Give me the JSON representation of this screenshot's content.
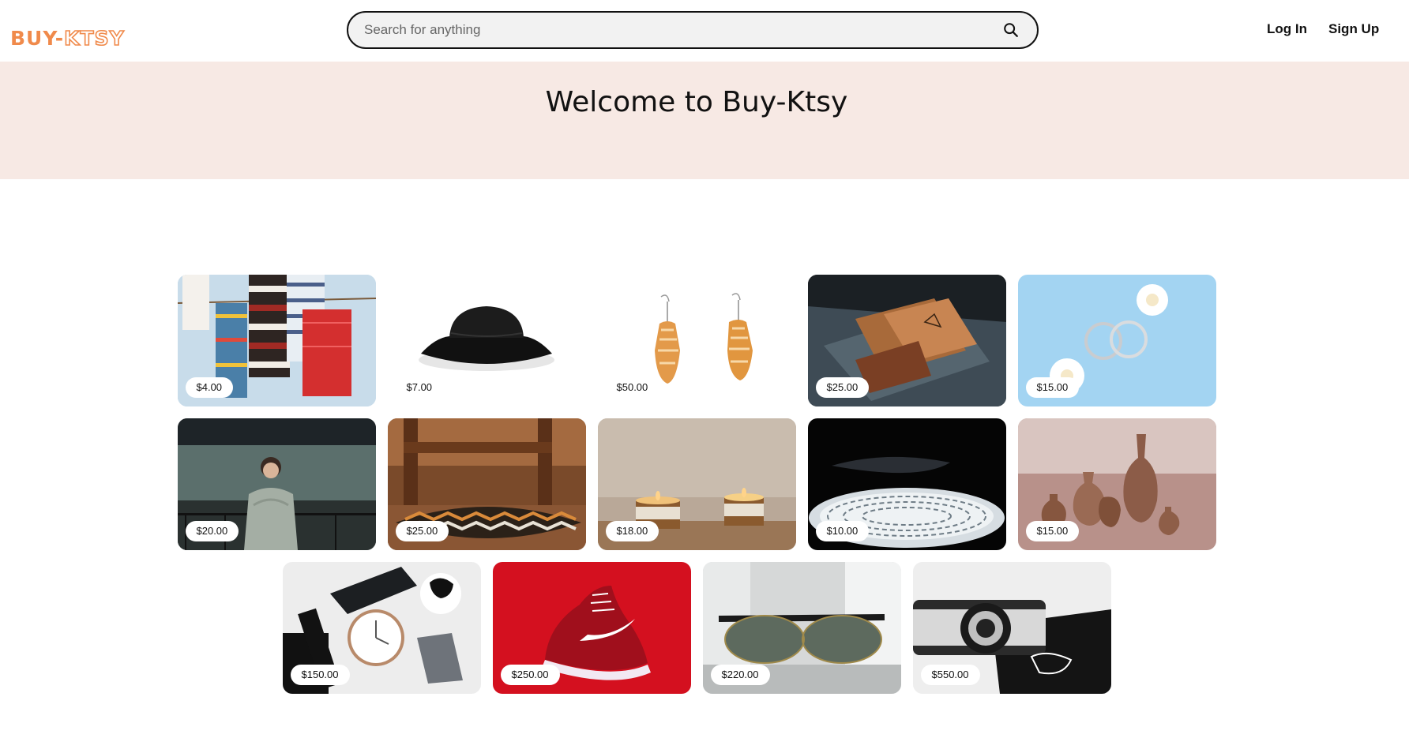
{
  "header": {
    "logo_prefix": "BUY-",
    "logo_suffix": "KTSY",
    "search_placeholder": "Search for anything",
    "search_icon": "search-icon",
    "login_label": "Log In",
    "signup_label": "Sign Up"
  },
  "banner": {
    "title": "Welcome to Buy-Ktsy"
  },
  "colors": {
    "brand": "#f08a4b",
    "banner_bg": "#f7e9e4",
    "search_bg": "#f2f2f2"
  },
  "products": [
    {
      "price": "$4.00",
      "image": "knitted-scarves"
    },
    {
      "price": "$7.00",
      "image": "black-bucket-hat"
    },
    {
      "price": "$50.00",
      "image": "seashell-earrings"
    },
    {
      "price": "$25.00",
      "image": "leather-card-wallets"
    },
    {
      "price": "$15.00",
      "image": "silver-hoop-earrings"
    },
    {
      "price": "$20.00",
      "image": "woman-in-knit-sweater"
    },
    {
      "price": "$25.00",
      "image": "patterned-floor-cushion"
    },
    {
      "price": "$18.00",
      "image": "amber-jar-candles"
    },
    {
      "price": "$10.00",
      "image": "patterned-ceramic-plate"
    },
    {
      "price": "$15.00",
      "image": "clay-vases"
    },
    {
      "price": "$150.00",
      "image": "wrist-watch"
    },
    {
      "price": "$250.00",
      "image": "red-running-shoe"
    },
    {
      "price": "$220.00",
      "image": "browline-sunglasses"
    },
    {
      "price": "$550.00",
      "image": "retro-camera"
    }
  ]
}
